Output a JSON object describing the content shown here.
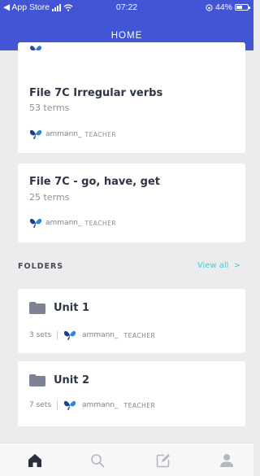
{
  "status_bar": {
    "carrier": "◀ App Store",
    "time": "07:22",
    "battery": "44%"
  },
  "header": {
    "title": "HOME"
  },
  "study_sets": [
    {
      "title": "File 7C Irregular verbs",
      "terms": "53 terms",
      "creator": "ammann_",
      "role": "TEACHER"
    },
    {
      "title": "File 7C - go, have, get",
      "terms": "25 terms",
      "creator": "ammann_",
      "role": "TEACHER"
    }
  ],
  "folders_section": {
    "label": "FOLDERS",
    "view_all": "View all",
    "view_all_chevron": ">"
  },
  "folders": [
    {
      "name": "Unit 1",
      "sets": "3 sets",
      "creator": "ammann_",
      "role": "TEACHER"
    },
    {
      "name": "Unit 2",
      "sets": "7 sets",
      "creator": "ammann_",
      "role": "TEACHER"
    }
  ],
  "tabbar": {
    "icons": [
      "home-icon",
      "search-icon",
      "create-icon",
      "profile-icon"
    ],
    "active": "home-icon"
  },
  "colors": {
    "brand": "#4255d4",
    "accent": "#3ccfcf",
    "background": "#ececee"
  }
}
